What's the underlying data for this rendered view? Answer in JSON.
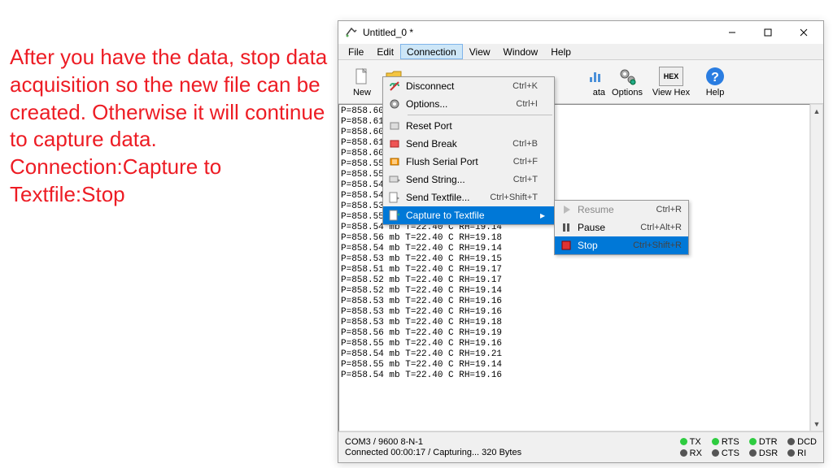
{
  "instruction": "After you have the data, stop data acquisition so the new file can be created.  Otherwise it will continue to capture data. Connection:Capture to Textfile:Stop",
  "title": "Untitled_0 *",
  "menubar": [
    "File",
    "Edit",
    "Connection",
    "View",
    "Window",
    "Help"
  ],
  "toolbar": {
    "new": "New",
    "open": "Op",
    "data": "ata",
    "options": "Options",
    "viewhex": "View Hex",
    "help": "Help",
    "hexIconText": "HEX"
  },
  "connection_menu": [
    {
      "icon": "disconnect-icon",
      "label": "Disconnect",
      "shortcut": "Ctrl+K"
    },
    {
      "icon": "options-icon",
      "label": "Options...",
      "shortcut": "Ctrl+I"
    },
    {
      "sep": true
    },
    {
      "icon": "reset-icon",
      "label": "Reset Port",
      "shortcut": ""
    },
    {
      "icon": "break-icon",
      "label": "Send Break",
      "shortcut": "Ctrl+B"
    },
    {
      "icon": "flush-icon",
      "label": "Flush Serial Port",
      "shortcut": "Ctrl+F"
    },
    {
      "icon": "sendstring-icon",
      "label": "Send String...",
      "shortcut": "Ctrl+T"
    },
    {
      "icon": "sendfile-icon",
      "label": "Send Textfile...",
      "shortcut": "Ctrl+Shift+T"
    },
    {
      "icon": "capture-icon",
      "label": "Capture to Textfile",
      "shortcut": "",
      "arrow": true,
      "hl": true
    }
  ],
  "submenu": [
    {
      "icon": "resume-icon",
      "label": "Resume",
      "shortcut": "Ctrl+R",
      "disabled": true
    },
    {
      "icon": "pause-icon",
      "label": "Pause",
      "shortcut": "Ctrl+Alt+R"
    },
    {
      "icon": "stop-icon",
      "label": "Stop",
      "shortcut": "Ctrl+Shift+R",
      "hl": true
    }
  ],
  "terminal_lines": [
    "P=858.60 :",
    "P=858.61 :",
    "P=858.60 :",
    "P=858.61 :",
    "P=858.60 :",
    "P=858.55 :",
    "P=858.55 !",
    "P=858.54 !",
    "P=858.54 mb T=22.41 C RH=19.16",
    "P=858.53 mb T=22.40 C RH=19.18",
    "P=858.55 mb T=22.40 C RH=19.19",
    "P=858.54 mb T=22.40 C RH=19.14",
    "P=858.56 mb T=22.40 C RH=19.18",
    "P=858.54 mb T=22.40 C RH=19.14",
    "P=858.53 mb T=22.40 C RH=19.15",
    "P=858.51 mb T=22.40 C RH=19.17",
    "P=858.52 mb T=22.40 C RH=19.17",
    "P=858.52 mb T=22.40 C RH=19.14",
    "P=858.53 mb T=22.40 C RH=19.16",
    "P=858.53 mb T=22.40 C RH=19.16",
    "P=858.53 mb T=22.40 C RH=19.18",
    "P=858.56 mb T=22.40 C RH=19.19",
    "P=858.55 mb T=22.40 C RH=19.16",
    "P=858.54 mb T=22.40 C RH=19.21",
    "P=858.55 mb T=22.40 C RH=19.14",
    "P=858.54 mb T=22.40 C RH=19.16"
  ],
  "status": {
    "line1": "COM3 / 9600 8-N-1",
    "line2": "Connected 00:00:17 / Capturing... 320 Bytes",
    "leds": [
      {
        "label": "TX",
        "on": true
      },
      {
        "label": "RTS",
        "on": true
      },
      {
        "label": "DTR",
        "on": true
      },
      {
        "label": "DCD",
        "on": false
      },
      {
        "label": "RX",
        "on": false
      },
      {
        "label": "CTS",
        "on": false
      },
      {
        "label": "DSR",
        "on": false
      },
      {
        "label": "RI",
        "on": false
      }
    ]
  }
}
